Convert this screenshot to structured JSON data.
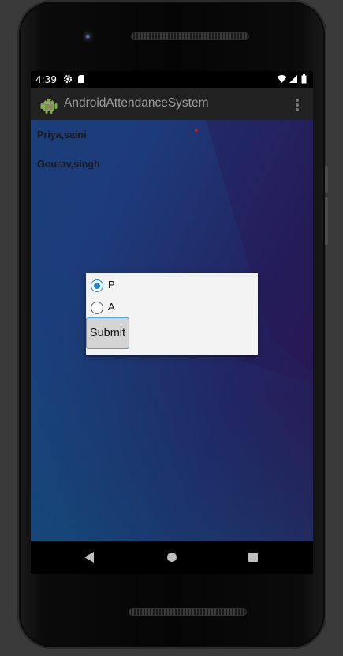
{
  "status_bar": {
    "time": "4:39",
    "icons": [
      "gear-icon",
      "sd-card-icon",
      "wifi-icon",
      "signal-icon",
      "battery-icon"
    ]
  },
  "app_bar": {
    "title": "AndroidAttendanceSystem",
    "icon": "android-icon",
    "menu_icon": "overflow-menu-icon"
  },
  "students": [
    {
      "name": "Priya,saini"
    },
    {
      "name": "Gourav,singh"
    }
  ],
  "dialog": {
    "options": [
      {
        "label": "P",
        "checked": true
      },
      {
        "label": "A",
        "checked": false
      }
    ],
    "submit_label": "Submit"
  },
  "nav_bar": {
    "buttons": [
      "back-icon",
      "home-icon",
      "recents-icon"
    ]
  },
  "colors": {
    "accent": "#1a8ad8",
    "app_bar": "#212121",
    "dialog_bg": "#f3f3f3"
  }
}
